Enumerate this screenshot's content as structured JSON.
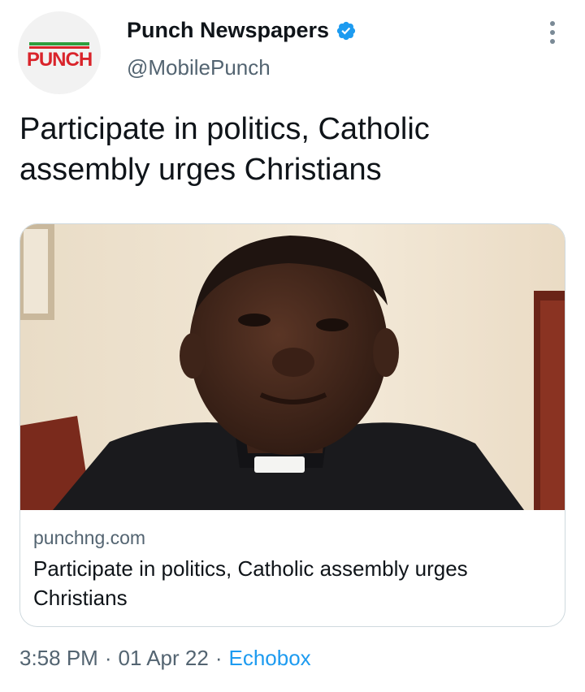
{
  "author": {
    "name": "Punch Newspapers",
    "handle": "@MobilePunch",
    "avatar_text": "PUNCH",
    "verified": true
  },
  "tweet": {
    "text": "Participate in politics, Catholic assembly urges Christians"
  },
  "card": {
    "domain": "punchng.com",
    "title": "Participate in politics, Catholic assembly urges Christians"
  },
  "footer": {
    "time": "3:58 PM",
    "separator": "·",
    "date": "01 Apr 22",
    "source": "Echobox"
  },
  "colors": {
    "link": "#1d9bf0",
    "secondary_text": "#536471",
    "verified_badge": "#1d9bf0",
    "logo_red": "#d9242b",
    "logo_green": "#2e9e3e"
  },
  "icons": {
    "verified": "verified-badge-icon",
    "more": "more-options-icon"
  }
}
